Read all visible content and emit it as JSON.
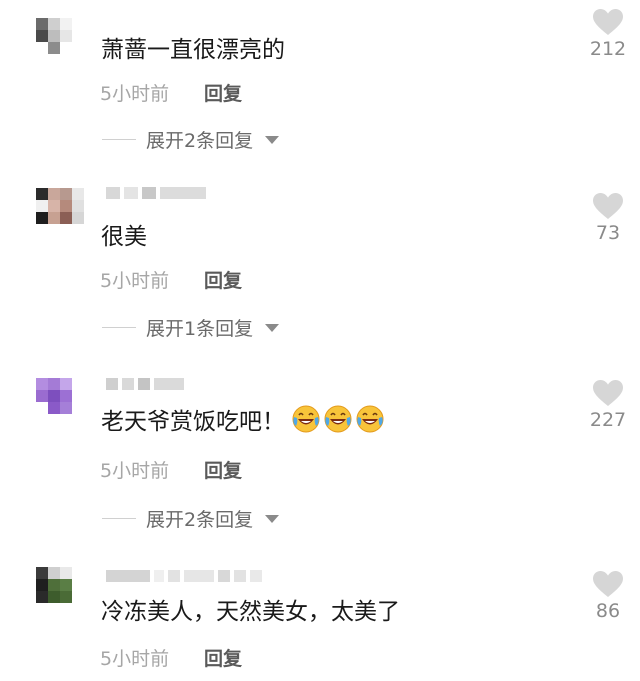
{
  "comments": [
    {
      "text": "萧蔷一直很漂亮的",
      "time": "5小时前",
      "reply_label": "回复",
      "expand_label": "展开2条回复",
      "likes": "212",
      "avatar_colors": [
        "#6b6b6b",
        "#cfcfcf",
        "#f2f2f2",
        "#ffffff",
        "#4a4a4a",
        "#bdbdbd",
        "#e6e6e6",
        "#ffffff",
        "#ffffff",
        "#8c8c8c",
        "#ffffff",
        "#ffffff",
        "#ffffff",
        "#ffffff",
        "#ffffff",
        "#ffffff"
      ]
    },
    {
      "text": "很美",
      "time": "5小时前",
      "reply_label": "回复",
      "expand_label": "展开1条回复",
      "likes": "73",
      "avatar_colors": [
        "#2b2b2b",
        "#c9a79b",
        "#b7998f",
        "#e8e8e8",
        "#f0f0f0",
        "#d7b4a8",
        "#b58a7c",
        "#e0e0e0",
        "#1e1e1e",
        "#c7a192",
        "#8b5f55",
        "#d6d6d6",
        "#ffffff",
        "#ffffff",
        "#ffffff",
        "#ffffff"
      ]
    },
    {
      "text": "老天爷赏饭吃吧！",
      "time": "5小时前",
      "reply_label": "回复",
      "expand_label": "展开2条回复",
      "likes": "227",
      "emoji_count": 3,
      "avatar_colors": [
        "#b38de0",
        "#a47bd6",
        "#c4a6ea",
        "#ffffff",
        "#9a6cd0",
        "#7d4fbe",
        "#9c70d4",
        "#ffffff",
        "#ffffff",
        "#8a5ac8",
        "#a57fd8",
        "#ffffff",
        "#ffffff",
        "#ffffff",
        "#ffffff",
        "#ffffff"
      ]
    },
    {
      "text": "冷冻美人，天然美女，太美了",
      "time": "5小时前",
      "reply_label": "回复",
      "likes": "86",
      "avatar_colors": [
        "#3b3b3b",
        "#cfcfcf",
        "#e9e9e9",
        "#ffffff",
        "#1f1f1f",
        "#4f6f3a",
        "#5a7e45",
        "#ffffff",
        "#2a2a2a",
        "#3d5c2c",
        "#4a6b36",
        "#ffffff",
        "#ffffff",
        "#ffffff",
        "#ffffff",
        "#ffffff"
      ]
    }
  ],
  "colors": {
    "text": "#1a1a1a",
    "meta": "#a6a6a6",
    "heart": "#d6d6d6"
  }
}
